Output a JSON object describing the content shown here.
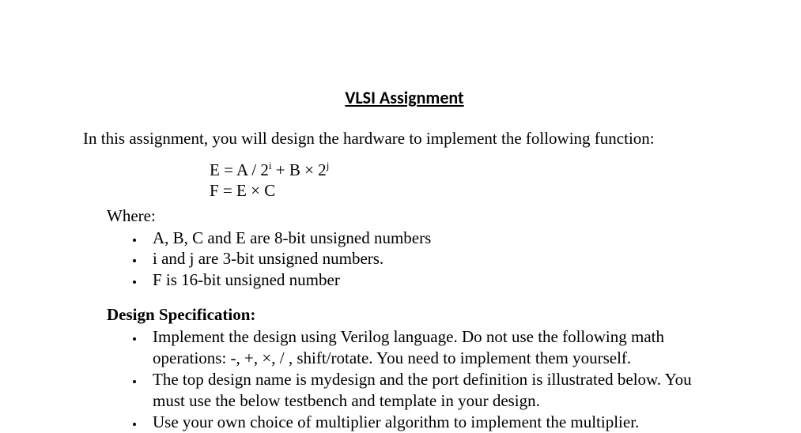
{
  "title": "VLSI Assignment",
  "intro": "In this assignment, you will design the hardware to implement the following function:",
  "equations": {
    "line1_pre": "E = A / 2",
    "line1_exp1": "i",
    "line1_mid": "  +   B × 2",
    "line1_exp2": "j",
    "line2": "F  = E × C"
  },
  "where_label": "Where:",
  "where_items": [
    "A, B, C and E are 8-bit unsigned numbers",
    "i and j are 3-bit unsigned numbers.",
    "F is 16-bit unsigned number"
  ],
  "spec_heading": "Design Specification:",
  "spec_items": [
    "Implement the design using Verilog language. Do not use the following math operations: -, +, ×, / , shift/rotate.   You need to implement them yourself.",
    "The top design name is mydesign and the port definition is illustrated below. You must use the below testbench and template in your design.",
    "Use your own choice of multiplier algorithm to implement the multiplier."
  ]
}
